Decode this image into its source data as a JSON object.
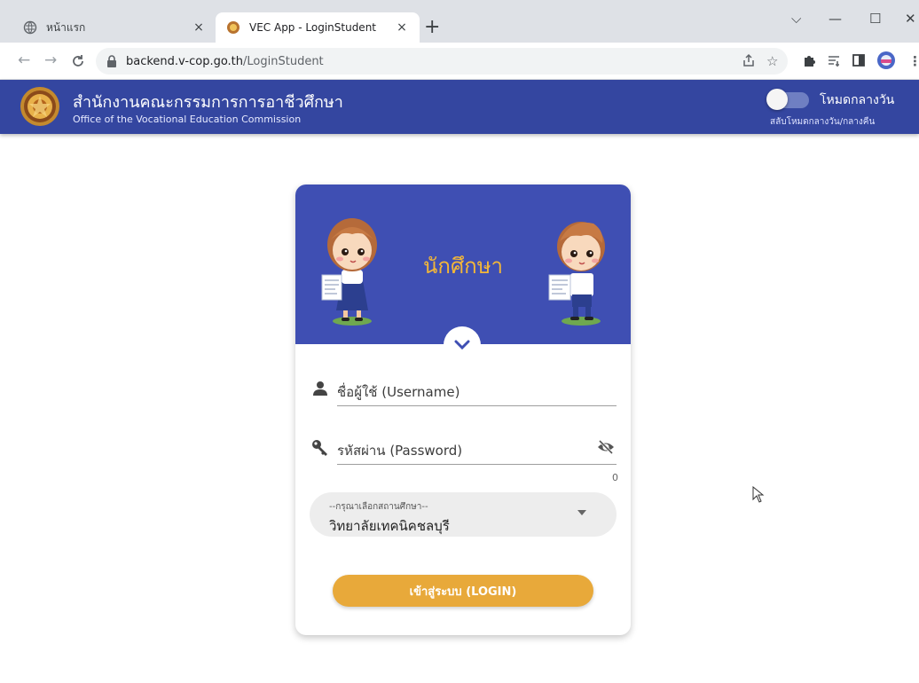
{
  "browser": {
    "tabs": [
      {
        "title": "หน้าแรก",
        "close": "×"
      },
      {
        "title": "VEC App - LoginStudent",
        "close": "×"
      }
    ],
    "new_tab": "+",
    "window_controls": {
      "dropdown": "⌵",
      "minimize": "—",
      "maximize": "☐",
      "close": "✕"
    },
    "url_host": "backend.v-cop.go.th",
    "url_path": "/LoginStudent"
  },
  "header": {
    "title_th": "สำนักงานคณะกรรมการการอาชีวศึกษา",
    "title_en": "Office of the Vocational Education Commission",
    "mode_label": "โหมดกลางวัน",
    "mode_sub": "สลับโหมดกลางวัน/กลางคืน"
  },
  "login": {
    "heading": "นักศึกษา",
    "username_label": "ชื่อผู้ใช้ (Username)",
    "password_label": "รหัสผ่าน (Password)",
    "char_counter": "0",
    "school_select_label": "--กรุณาเลือกสถานศึกษา--",
    "school_select_value": "วิทยาลัยเทคนิคชลบุรี",
    "login_button": "เข้าสู่ระบบ (LOGIN)"
  },
  "colors": {
    "header_bg": "#3446a0",
    "hero_bg": "#3f4fb3",
    "accent_gold": "#e8a93a",
    "title_gold": "#f3b738"
  }
}
